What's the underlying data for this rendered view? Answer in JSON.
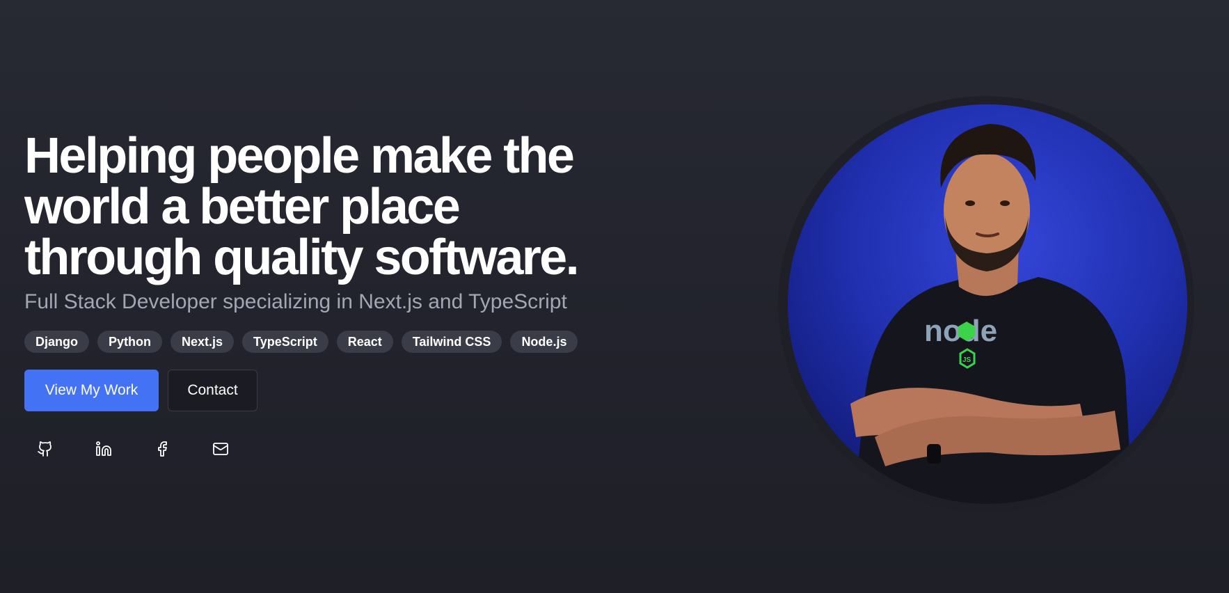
{
  "hero": {
    "headline_lines": [
      "Helping people make the",
      "world a better place",
      "through quality software."
    ],
    "subtitle": "Full Stack Developer specializing in Next.js and TypeScript",
    "tags": [
      "Django",
      "Python",
      "Next.js",
      "TypeScript",
      "React",
      "Tailwind CSS",
      "Node.js"
    ],
    "primary_button": "View My Work",
    "secondary_button": "Contact",
    "socials": [
      {
        "icon": "github-icon"
      },
      {
        "icon": "linkedin-icon"
      },
      {
        "icon": "facebook-icon"
      },
      {
        "icon": "mail-icon"
      }
    ],
    "portrait": {
      "shirt_logo_text": "node",
      "shirt_logo_badge": "JS"
    }
  },
  "colors": {
    "background": "#25262f",
    "accent": "#4472f5",
    "tag_background": "#3a3c47",
    "subtitle": "#a3a6b4"
  }
}
